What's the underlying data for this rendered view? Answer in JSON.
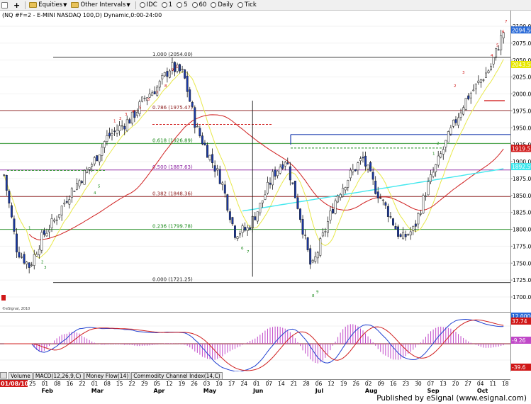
{
  "toolbar": {
    "symbol_box": "",
    "add_label": "+",
    "equities_label": "Equities",
    "other_intervals_label": "Other Intervals",
    "intervals": [
      "IDC",
      "1",
      "5",
      "60",
      "Daily",
      "Tick"
    ]
  },
  "chart": {
    "header_text": "(NQ #F=2 - E-MINI NASDAQ 100,D) Dynamic,0:00-24:00",
    "copyright": "©eSignal, 2010",
    "price_axis": {
      "labels": [
        "2100.00",
        "2075.00",
        "2050.00",
        "2025.00",
        "2000.00",
        "1975.00",
        "1950.00",
        "1925.00",
        "1900.00",
        "1875.00",
        "1850.00",
        "1825.00",
        "1800.00",
        "1775.00",
        "1750.00",
        "1725.00",
        "1700.00"
      ],
      "markers": [
        {
          "label": "2094.50",
          "value": 2094.5,
          "color": "#2b6bd8"
        },
        {
          "label": "2043.50",
          "value": 2043.5,
          "color": "#e8e800"
        },
        {
          "label": "1919.53",
          "value": 1919.53,
          "color": "#d01818"
        },
        {
          "label": "1892.59",
          "value": 1892.59,
          "color": "#44e8ee"
        }
      ]
    },
    "fib_levels": [
      {
        "label": "1.000 (2054.00)",
        "value": 2054.0,
        "color": "#202020"
      },
      {
        "label": "0.786 (1975.47)",
        "value": 1975.47,
        "color": "#8b1a1a"
      },
      {
        "label": "0.618 (1926.89)",
        "value": 1926.89,
        "color": "#1a8a1a"
      },
      {
        "label": "0.500 (1887.63)",
        "value": 1887.63,
        "color": "#8a20a0"
      },
      {
        "label": "0.382 (1848.36)",
        "value": 1848.36,
        "color": "#8b1a1a"
      },
      {
        "label": "0.236 (1799.78)",
        "value": 1799.78,
        "color": "#1a8a1a"
      },
      {
        "label": "0.000 (1721.25)",
        "value": 1721.25,
        "color": "#202020"
      }
    ],
    "price_range": [
      1690,
      2128
    ],
    "x_axis": {
      "start_label": "01/08/10",
      "day_labels": [
        "25",
        "01",
        "08",
        "16",
        "22",
        "01",
        "08",
        "15",
        "22",
        "29",
        "05",
        "12",
        "19",
        "26",
        "03",
        "10",
        "17",
        "24",
        "01",
        "07",
        "14",
        "21",
        "28",
        "06",
        "12",
        "19",
        "26",
        "02",
        "09",
        "16",
        "23",
        "30",
        "07",
        "13",
        "20",
        "27",
        "04",
        "11",
        "18"
      ],
      "month_labels": [
        "Feb",
        "Mar",
        "Apr",
        "May",
        "Jun",
        "Jul",
        "Aug",
        "Sep",
        "Oct"
      ]
    }
  },
  "macd": {
    "axis_labels": [
      {
        "label": "12.0000",
        "value": 12.0,
        "color": "#2b6bd8"
      },
      {
        "label": "37.74",
        "value": 37.74,
        "color": "#d01818"
      },
      {
        "label": "-9.26",
        "value": -9.26,
        "color": "#c048c8"
      },
      {
        "label": "-39.6",
        "value": -39.6,
        "color": "#d01818"
      }
    ]
  },
  "tabs": [
    "Volume",
    "MACD(12,26,9,C)",
    "Money Flow(14)",
    "Commodity Channel Index(14,C)"
  ],
  "footer": {
    "published": "Published by eSignal (www.esignal.com)"
  },
  "chart_data": {
    "type": "line",
    "title": "(NQ #F=2 - E-MINI NASDAQ 100,D) Dynamic,0:00-24:00",
    "xlabel": "",
    "ylabel": "",
    "x": [
      "Jan 8",
      "Jan 25",
      "Feb 1",
      "Feb 8",
      "Feb 16",
      "Feb 22",
      "Mar 1",
      "Mar 8",
      "Mar 15",
      "Mar 22",
      "Mar 29",
      "Apr 5",
      "Apr 12",
      "Apr 19",
      "Apr 26",
      "May 3",
      "May 10",
      "May 17",
      "May 24",
      "Jun 1",
      "Jun 7",
      "Jun 14",
      "Jun 21",
      "Jun 28",
      "Jul 6",
      "Jul 12",
      "Jul 19",
      "Jul 26",
      "Aug 2",
      "Aug 9",
      "Aug 16",
      "Aug 23",
      "Aug 30",
      "Sep 7",
      "Sep 13",
      "Sep 20",
      "Sep 27",
      "Oct 4",
      "Oct 11",
      "Oct 18"
    ],
    "ylim": [
      1690,
      2128
    ],
    "series": [
      {
        "name": "",
        "values": [
          1880,
          1770,
          1745,
          1790,
          1815,
          1850,
          1875,
          1900,
          1935,
          1950,
          1965,
          1995,
          2010,
          2040,
          2030,
          1950,
          1910,
          1870,
          1795,
          1800,
          1835,
          1880,
          1905,
          1830,
          1740,
          1795,
          1850,
          1880,
          1905,
          1860,
          1825,
          1785,
          1800,
          1860,
          1905,
          1950,
          1990,
          2015,
          2040,
          2092
        ]
      }
    ]
  }
}
